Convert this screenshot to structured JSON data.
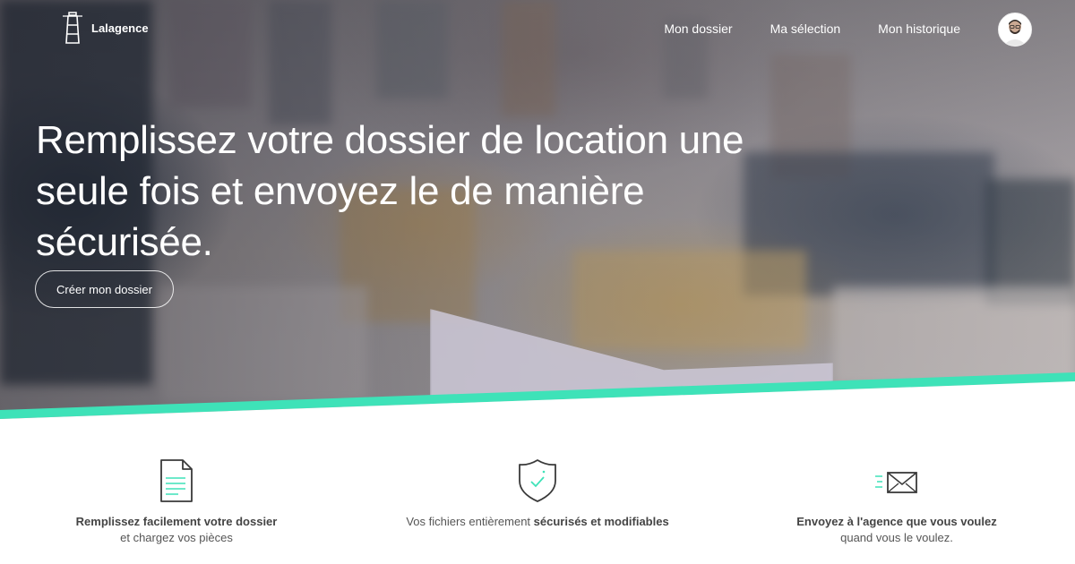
{
  "brand": {
    "name": "Lalagence",
    "logo_icon": "lighthouse-icon"
  },
  "nav": {
    "items": [
      {
        "label": "Mon dossier"
      },
      {
        "label": "Ma sélection"
      },
      {
        "label": "Mon historique"
      }
    ],
    "avatar_icon": "user-avatar"
  },
  "hero": {
    "headline": "Remplissez votre dossier de location une seule fois et envoyez le de manière sécurisée.",
    "cta_label": "Créer mon dossier"
  },
  "features": [
    {
      "icon": "document-icon",
      "bold": "Remplissez facilement votre dossier",
      "rest": "et chargez vos pièces"
    },
    {
      "icon": "shield-check-icon",
      "prefix": "Vos fichiers entièrement ",
      "bold": "sécurisés et modifiables"
    },
    {
      "icon": "envelope-icon",
      "bold": "Envoyez à l'agence que vous voulez",
      "rest": "quand vous le voulez."
    }
  ],
  "colors": {
    "accent": "#3ee2b8",
    "text": "#555555",
    "hero_text": "#ffffff"
  }
}
